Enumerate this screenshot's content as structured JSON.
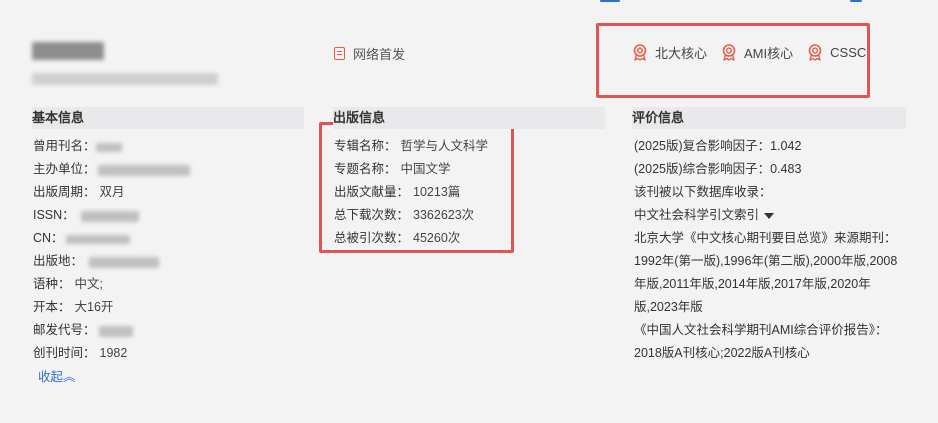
{
  "header": {
    "first_publish": "网络首发",
    "badges": [
      {
        "label": "北大核心",
        "icon": "award-icon"
      },
      {
        "label": "AMI核心",
        "icon": "award-icon"
      },
      {
        "label": "CSSCI",
        "icon": "award-icon"
      }
    ]
  },
  "basic": {
    "title": "基本信息",
    "former_name_label": "曾用刊名：",
    "sponsor_label": "主办单位：",
    "cycle_label": "出版周期：",
    "cycle_value": "双月",
    "issn_label": "ISSN：",
    "cn_label": "CN：",
    "place_label": "出版地：",
    "language_label": "语种：",
    "language_value": "中文;",
    "format_label": "开本：",
    "format_value": "大16开",
    "postal_label": "邮发代号：",
    "founded_label": "创刊时间：",
    "founded_value": "1982",
    "collapse": "收起︽"
  },
  "publication": {
    "title": "出版信息",
    "rows": [
      {
        "label": "专辑名称：",
        "value": "哲学与人文科学"
      },
      {
        "label": "专题名称：",
        "value": "中国文学"
      },
      {
        "label": "出版文献量：",
        "value": "10213篇"
      },
      {
        "label": "总下载次数：",
        "value": "3362623次"
      },
      {
        "label": "总被引次数：",
        "value": "45260次"
      }
    ]
  },
  "evaluation": {
    "title": "评价信息",
    "composite_if": "(2025版)复合影响因子：1.042",
    "comprehensive_if": "(2025版)综合影响因子：0.483",
    "db_intro": "该刊被以下数据库收录：",
    "db_select": "中文社会科学引文索引",
    "pku_source": "北京大学《中文核心期刊要目总览》来源期刊：",
    "pku_versions": "1992年(第一版),1996年(第二版),2000年版,2008年版,2011年版,2014年版,2017年版,2020年版,2023年版",
    "ami_report": "《中国人文社会科学期刊AMI综合评价报告》：",
    "ami_versions": "2018版A刊核心;2022版A刊核心"
  }
}
